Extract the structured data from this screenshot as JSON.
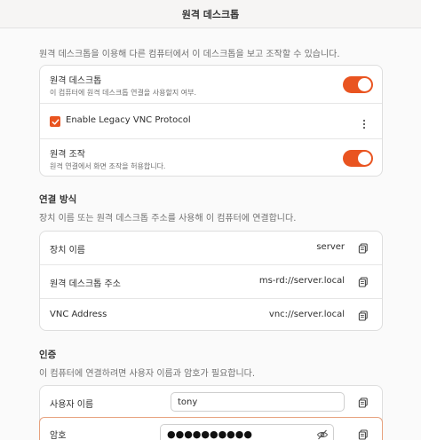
{
  "window": {
    "title": "원격 데스크톱"
  },
  "intro": {
    "description": "원격 데스크톱을 이용해 다른 컴퓨터에서 이 데스크톱을 보고 조작할 수 있습니다."
  },
  "sharing": {
    "remote_desktop": {
      "title": "원격 데스크톱",
      "subtitle": "이 컴퓨터에 원격 데스크톱 연결을 사용할지 여부.",
      "enabled": true
    },
    "legacy_vnc": {
      "label": "Enable Legacy VNC Protocol",
      "checked": true
    },
    "remote_control": {
      "title": "원격 조작",
      "subtitle": "원격 연결에서 화면 조작을 허용합니다.",
      "enabled": true
    }
  },
  "connection": {
    "heading": "연결 방식",
    "description": "장치 이름 또는 원격 데스크톱 주소를 사용해 이 컴퓨터에 연결합니다.",
    "device_name": {
      "label": "장치 이름",
      "value": "server"
    },
    "rdp_address": {
      "label": "원격 데스크톱 주소",
      "value": "ms-rd://server.local"
    },
    "vnc_address": {
      "label": "VNC Address",
      "value": "vnc://server.local"
    }
  },
  "auth": {
    "heading": "인증",
    "description": "이 컴퓨터에 연결하려면 사용자 이름과 암호가 필요합니다.",
    "username": {
      "label": "사용자 이름",
      "value": "tony"
    },
    "password": {
      "label": "암호",
      "value": "●●●●●●●●●●"
    }
  },
  "colors": {
    "accent": "#e95420",
    "background": "#fafafa",
    "card": "#ffffff"
  },
  "icons": {
    "copy": "copy-icon",
    "menu": "kebab-menu-icon",
    "reveal": "eye-hidden-icon",
    "check": "checkmark-icon"
  }
}
